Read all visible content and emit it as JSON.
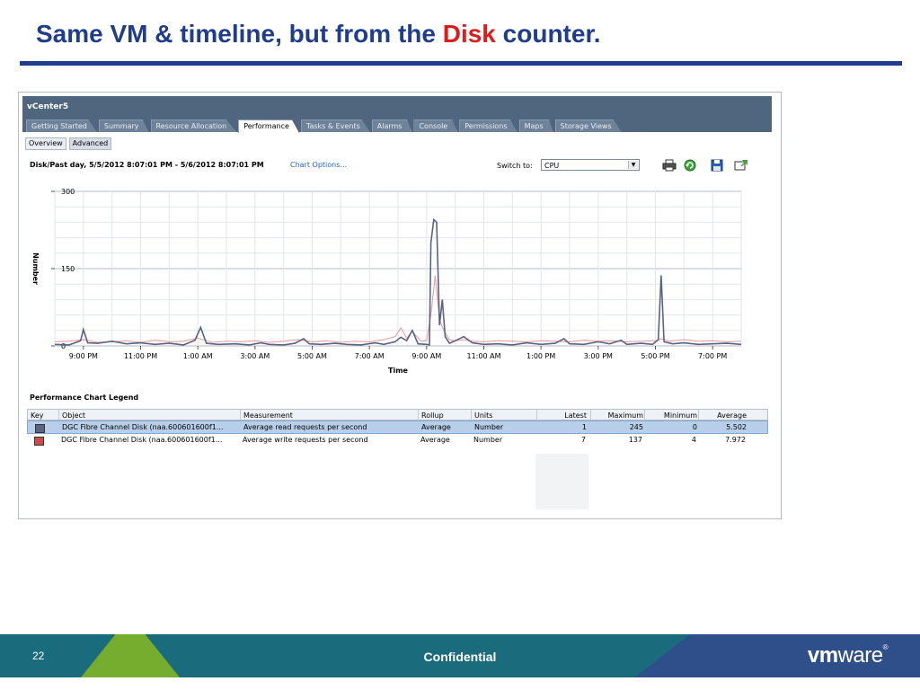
{
  "slide": {
    "title_before": "Same VM & timeline, but from the ",
    "title_accent": "Disk",
    "title_after": " counter.",
    "page_number": "22",
    "footer_text": "Confidential",
    "logo": {
      "vm": "vm",
      "ware": "ware",
      "reg": "®"
    }
  },
  "app": {
    "title": "vCenter5",
    "tabs": [
      {
        "label": "Getting Started",
        "active": false
      },
      {
        "label": "Summary",
        "active": false
      },
      {
        "label": "Resource Allocation",
        "active": false
      },
      {
        "label": "Performance",
        "active": true
      },
      {
        "label": "Tasks & Events",
        "active": false
      },
      {
        "label": "Alarms",
        "active": false
      },
      {
        "label": "Console",
        "active": false
      },
      {
        "label": "Permissions",
        "active": false
      },
      {
        "label": "Maps",
        "active": false
      },
      {
        "label": "Storage Views",
        "active": false
      }
    ],
    "subtabs": [
      {
        "label": "Overview",
        "active": false
      },
      {
        "label": "Advanced",
        "active": true
      }
    ],
    "chart_title": "Disk/Past day, 5/5/2012 8:07:01 PM - 5/6/2012 8:07:01 PM",
    "chart_options_link": "Chart Options...",
    "switch_to_label": "Switch to:",
    "switch_to_value": "CPU",
    "toolbar_icons": [
      "print-icon",
      "refresh-icon",
      "save-icon",
      "export-icon"
    ]
  },
  "chart_data": {
    "type": "line",
    "xlabel": "Time",
    "ylabel": "Number",
    "ylim": [
      0,
      300
    ],
    "yticks": [
      "300",
      "150",
      "0"
    ],
    "x_tick_labels": [
      "9:00 PM",
      "11:00 PM",
      "1:00 AM",
      "3:00 AM",
      "5:00 AM",
      "7:00 AM",
      "9:00 AM",
      "11:00 AM",
      "1:00 PM",
      "3:00 PM",
      "5:00 PM",
      "7:00 PM"
    ],
    "x_range_hours": [
      0,
      24
    ],
    "grid": true,
    "series": [
      {
        "name": "Average read requests per second",
        "color": "#5a6482",
        "points": [
          [
            0,
            3
          ],
          [
            0.5,
            2
          ],
          [
            0.9,
            10
          ],
          [
            1.0,
            32
          ],
          [
            1.15,
            6
          ],
          [
            1.5,
            5
          ],
          [
            2.0,
            9
          ],
          [
            2.5,
            4
          ],
          [
            3.0,
            6
          ],
          [
            3.5,
            3
          ],
          [
            4.0,
            5
          ],
          [
            4.5,
            2
          ],
          [
            4.9,
            11
          ],
          [
            5.1,
            36
          ],
          [
            5.3,
            5
          ],
          [
            5.7,
            3
          ],
          [
            6.3,
            4
          ],
          [
            6.8,
            2
          ],
          [
            7.2,
            6
          ],
          [
            7.5,
            3
          ],
          [
            8.0,
            2
          ],
          [
            8.4,
            5
          ],
          [
            8.7,
            14
          ],
          [
            8.9,
            4
          ],
          [
            9.3,
            3
          ],
          [
            9.8,
            5
          ],
          [
            10.2,
            3
          ],
          [
            10.7,
            2
          ],
          [
            11.2,
            6
          ],
          [
            11.5,
            3
          ],
          [
            11.9,
            8
          ],
          [
            12.1,
            17
          ],
          [
            12.3,
            10
          ],
          [
            12.5,
            30
          ],
          [
            12.7,
            4
          ],
          [
            13.0,
            3
          ],
          [
            13.1,
            2
          ],
          [
            13.15,
            200
          ],
          [
            13.25,
            245
          ],
          [
            13.35,
            240
          ],
          [
            13.45,
            40
          ],
          [
            13.55,
            90
          ],
          [
            13.65,
            18
          ],
          [
            13.8,
            5
          ],
          [
            14.0,
            10
          ],
          [
            14.3,
            18
          ],
          [
            14.6,
            6
          ],
          [
            15.0,
            3
          ],
          [
            15.5,
            4
          ],
          [
            16.0,
            2
          ],
          [
            16.5,
            6
          ],
          [
            17.0,
            3
          ],
          [
            17.5,
            5
          ],
          [
            17.8,
            14
          ],
          [
            18.0,
            4
          ],
          [
            18.5,
            3
          ],
          [
            19.0,
            8
          ],
          [
            19.4,
            4
          ],
          [
            19.8,
            11
          ],
          [
            20.0,
            3
          ],
          [
            20.5,
            5
          ],
          [
            20.9,
            3
          ],
          [
            21.1,
            12
          ],
          [
            21.2,
            137
          ],
          [
            21.3,
            8
          ],
          [
            21.6,
            4
          ],
          [
            22.0,
            6
          ],
          [
            22.5,
            3
          ],
          [
            23.0,
            4
          ],
          [
            23.5,
            5
          ],
          [
            24.0,
            3
          ]
        ]
      },
      {
        "name": "Average write requests per second",
        "color": "#e8a0a0",
        "points": [
          [
            0,
            8
          ],
          [
            0.5,
            9
          ],
          [
            1.0,
            12
          ],
          [
            1.5,
            7
          ],
          [
            2.0,
            8
          ],
          [
            2.5,
            10
          ],
          [
            3.0,
            7
          ],
          [
            3.5,
            11
          ],
          [
            4.0,
            8
          ],
          [
            4.5,
            9
          ],
          [
            5.0,
            15
          ],
          [
            5.5,
            7
          ],
          [
            6.0,
            9
          ],
          [
            6.5,
            8
          ],
          [
            7.0,
            10
          ],
          [
            7.5,
            7
          ],
          [
            8.0,
            9
          ],
          [
            8.5,
            12
          ],
          [
            9.0,
            8
          ],
          [
            9.5,
            10
          ],
          [
            10.0,
            7
          ],
          [
            10.5,
            9
          ],
          [
            11.0,
            8
          ],
          [
            11.5,
            12
          ],
          [
            11.9,
            18
          ],
          [
            12.1,
            35
          ],
          [
            12.3,
            15
          ],
          [
            12.5,
            28
          ],
          [
            12.8,
            9
          ],
          [
            13.0,
            10
          ],
          [
            13.15,
            60
          ],
          [
            13.3,
            137
          ],
          [
            13.45,
            50
          ],
          [
            13.6,
            30
          ],
          [
            13.8,
            12
          ],
          [
            14.0,
            10
          ],
          [
            14.3,
            12
          ],
          [
            14.6,
            9
          ],
          [
            15.0,
            8
          ],
          [
            15.5,
            10
          ],
          [
            16.0,
            9
          ],
          [
            16.5,
            8
          ],
          [
            17.0,
            10
          ],
          [
            17.5,
            9
          ],
          [
            18.0,
            8
          ],
          [
            18.5,
            11
          ],
          [
            19.0,
            9
          ],
          [
            19.5,
            10
          ],
          [
            20.0,
            8
          ],
          [
            20.5,
            9
          ],
          [
            21.0,
            10
          ],
          [
            21.2,
            14
          ],
          [
            21.5,
            9
          ],
          [
            22.0,
            12
          ],
          [
            22.5,
            9
          ],
          [
            23.0,
            10
          ],
          [
            23.5,
            8
          ],
          [
            24.0,
            9
          ]
        ]
      }
    ]
  },
  "legend": {
    "heading": "Performance Chart Legend",
    "columns": [
      "Key",
      "Object",
      "Measurement",
      "Rollup",
      "Units",
      "Latest",
      "Maximum",
      "Minimum",
      "Average"
    ],
    "rows": [
      {
        "key_color": "#5a6482",
        "object": "DGC Fibre Channel Disk (naa.600601600f1...",
        "measurement": "Average read requests per second",
        "rollup": "Average",
        "units": "Number",
        "latest": "1",
        "maximum": "245",
        "minimum": "0",
        "average": "5.502",
        "selected": true
      },
      {
        "key_color": "#d04a4a",
        "object": "DGC Fibre Channel Disk (naa.600601600f1...",
        "measurement": "Average write requests per second",
        "rollup": "Average",
        "units": "Number",
        "latest": "7",
        "maximum": "137",
        "minimum": "4",
        "average": "7.972",
        "selected": false
      }
    ]
  }
}
